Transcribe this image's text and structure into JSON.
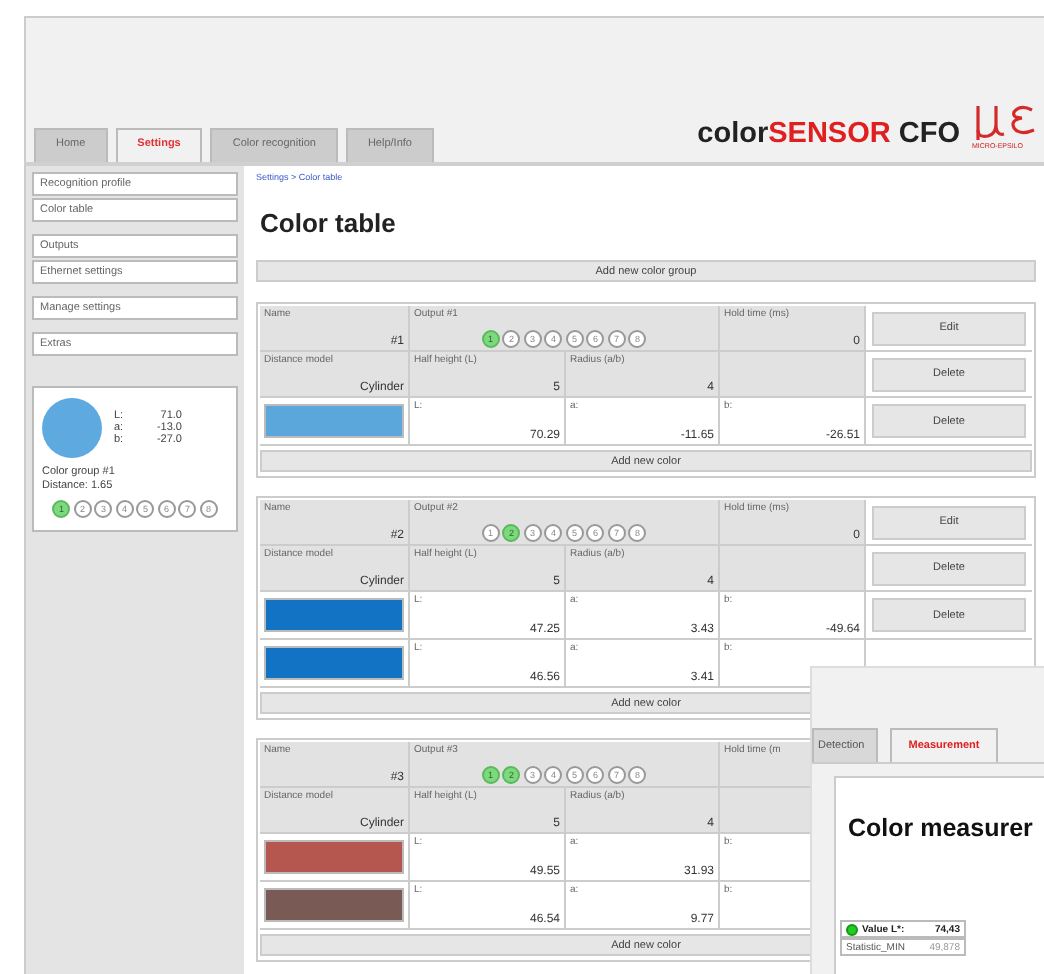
{
  "header": {
    "tabs": [
      {
        "label": "Home",
        "selected": false
      },
      {
        "label": "Settings",
        "selected": true
      },
      {
        "label": "Color recognition",
        "selected": false
      },
      {
        "label": "Help/Info",
        "selected": false
      }
    ],
    "product": [
      {
        "text": "color",
        "kind": "plain"
      },
      {
        "text": "SENSOR",
        "kind": "accent"
      },
      {
        "text": " CFO",
        "kind": "plain"
      }
    ],
    "logo_caption": "MICRO-EPSILO"
  },
  "sidebar": {
    "groups": [
      {
        "items": [
          "Recognition profile",
          "Color table"
        ]
      },
      {
        "items": [
          "Outputs",
          "Ethernet settings"
        ]
      },
      {
        "items": [
          "Manage settings"
        ]
      },
      {
        "items": [
          "Extras"
        ]
      }
    ],
    "preview": {
      "color": "#5eaae0",
      "values": [
        {
          "label": "L:",
          "value": "71.0"
        },
        {
          "label": "a:",
          "value": "-13.0"
        },
        {
          "label": "b:",
          "value": "-27.0"
        }
      ],
      "group": "Color group #1",
      "distance": "Distance: 1.65",
      "outputs": [
        {
          "label": "1",
          "selected": true
        },
        {
          "label": "2",
          "selected": false
        },
        {
          "label": "3",
          "selected": false
        },
        {
          "label": "4",
          "selected": false
        },
        {
          "label": "5",
          "selected": false
        },
        {
          "label": "6",
          "selected": false
        },
        {
          "label": "7",
          "selected": false
        },
        {
          "label": "8",
          "selected": false
        }
      ]
    }
  },
  "breadcrumb": "Settings > Color table",
  "title": "Color table",
  "add_group_button": "Add new color group",
  "groups": [
    {
      "name_label": "Name",
      "name": "#1",
      "output_label": "Output #1",
      "outputs": [
        {
          "label": "1",
          "selected": true
        },
        {
          "label": "2",
          "selected": false
        },
        {
          "label": "3",
          "selected": false
        },
        {
          "label": "4",
          "selected": false
        },
        {
          "label": "5",
          "selected": false
        },
        {
          "label": "6",
          "selected": false
        },
        {
          "label": "7",
          "selected": false
        },
        {
          "label": "8",
          "selected": false
        }
      ],
      "hold_label": "Hold time (ms)",
      "hold": "0",
      "edit_button": "Edit",
      "model_label": "Distance model",
      "model": "Cylinder",
      "half_label": "Half height (L)",
      "half": "5",
      "radius_label": "Radius (a/b)",
      "radius": "4",
      "delete_button": "Delete",
      "colors": [
        {
          "color": "#5ba7db",
          "l_label": "L:",
          "l": "70.29",
          "a_label": "a:",
          "a": "-11.65",
          "b_label": "b:",
          "b": "-26.51",
          "button": "Delete"
        }
      ],
      "add_color": "Add new color"
    },
    {
      "name_label": "Name",
      "name": "#2",
      "output_label": "Output #2",
      "outputs": [
        {
          "label": "1",
          "selected": false
        },
        {
          "label": "2",
          "selected": true
        },
        {
          "label": "3",
          "selected": false
        },
        {
          "label": "4",
          "selected": false
        },
        {
          "label": "5",
          "selected": false
        },
        {
          "label": "6",
          "selected": false
        },
        {
          "label": "7",
          "selected": false
        },
        {
          "label": "8",
          "selected": false
        }
      ],
      "hold_label": "Hold time (ms)",
      "hold": "0",
      "edit_button": "Edit",
      "model_label": "Distance model",
      "model": "Cylinder",
      "half_label": "Half height (L)",
      "half": "5",
      "radius_label": "Radius (a/b)",
      "radius": "4",
      "delete_button": "Delete",
      "colors": [
        {
          "color": "#1272c4",
          "l_label": "L:",
          "l": "47.25",
          "a_label": "a:",
          "a": "3.43",
          "b_label": "b:",
          "b": "-49.64",
          "button": "Delete"
        },
        {
          "color": "#1272c4",
          "l_label": "L:",
          "l": "46.56",
          "a_label": "a:",
          "a": "3.41",
          "b_label": "b:"
        }
      ],
      "add_color": "Add new color"
    },
    {
      "name_label": "Name",
      "name": "#3",
      "output_label": "Output #3",
      "outputs": [
        {
          "label": "1",
          "selected": true
        },
        {
          "label": "2",
          "selected": true
        },
        {
          "label": "3",
          "selected": false
        },
        {
          "label": "4",
          "selected": false
        },
        {
          "label": "5",
          "selected": false
        },
        {
          "label": "6",
          "selected": false
        },
        {
          "label": "7",
          "selected": false
        },
        {
          "label": "8",
          "selected": false
        }
      ],
      "hold_label": "Hold time (m",
      "model_label": "Distance model",
      "model": "Cylinder",
      "half_label": "Half height (L)",
      "half": "5",
      "radius_label": "Radius (a/b)",
      "radius": "4",
      "colors": [
        {
          "color": "#b5574f",
          "l_label": "L:",
          "l": "49.55",
          "a_label": "a:",
          "a": "31.93",
          "b_label": "b:"
        },
        {
          "color": "#7a5a55",
          "l_label": "L:",
          "l": "46.54",
          "a_label": "a:",
          "a": "9.77",
          "b_label": "b:"
        }
      ],
      "add_color": "Add new color"
    }
  ],
  "measure_window": {
    "tabs": [
      {
        "label": "Detection",
        "selected": false
      },
      {
        "label": "Measurement",
        "selected": true
      }
    ],
    "heading": "Color measurer",
    "rows": [
      {
        "kind": "status",
        "label": "Value L*:",
        "value": "74,43"
      },
      {
        "kind": "plain",
        "label": "Statistic_MIN",
        "value": "49,878"
      }
    ]
  }
}
